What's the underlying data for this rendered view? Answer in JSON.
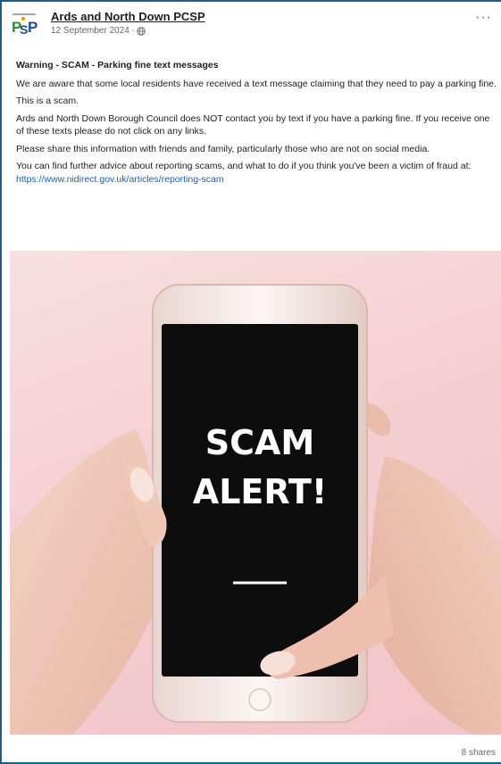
{
  "post": {
    "author": "Ards and North Down PCSP",
    "avatar_text": "PCSP",
    "date": "12 September 2024 ·",
    "globe_icon": "globe-icon",
    "more_label": "···",
    "title": "Warning - SCAM - Parking fine text messages",
    "paragraphs": [
      "We are aware that some local residents have received a text message claiming that they need to pay a parking fine.",
      "This is a scam.",
      "Ards and North Down Borough Council does NOT contact you by text if you have a parking fine. If you receive one of these texts please do not click on any links.",
      "Please share this information with friends and family, particularly those who are not on social media."
    ],
    "last_paragraph_prefix": "You can find further advice about reporting scams, and what to do if you think you've been a victim of fraud at: ",
    "link_text": "https://www.nidirect.gov.uk/articles/reporting-scam",
    "image": {
      "screen_line1": "SCAM",
      "screen_line2": "ALERT!"
    },
    "shares": "8 shares"
  },
  "colors": {
    "border": "#1d5f8a",
    "link": "#1a5fb4",
    "pink_bg": "#f4cfd2",
    "phone_screen": "#0d0d0d"
  }
}
